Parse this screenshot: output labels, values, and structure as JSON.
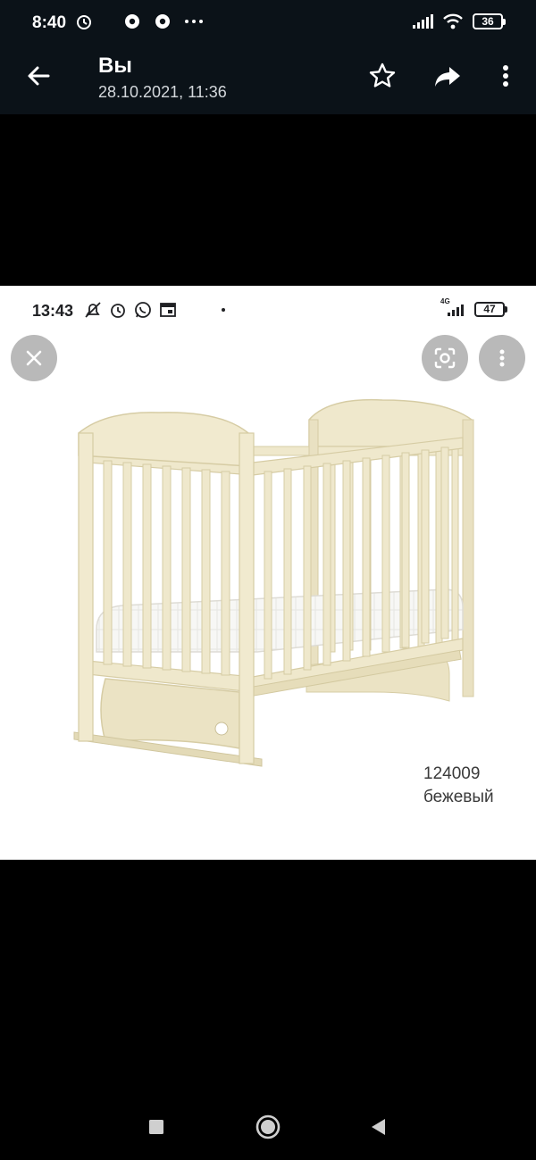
{
  "status_bar": {
    "time": "8:40",
    "battery": "36",
    "left_icons": [
      "alarm-icon",
      "chrome-icon",
      "chrome-icon",
      "more-notifications-icon"
    ],
    "right_icons": [
      "signal-icon",
      "wifi-icon",
      "battery-icon"
    ]
  },
  "app_bar": {
    "title": "Вы",
    "subtitle": "28.10.2021, 11:36",
    "actions": [
      "star-icon",
      "share-icon",
      "overflow-menu-icon"
    ]
  },
  "photo": {
    "inner_status": {
      "time": "13:43",
      "network": "4G",
      "battery": "47",
      "icons": [
        "mute-alarm-icon",
        "alarm-icon",
        "whatsapp-icon",
        "calendar-icon",
        "dot-icon",
        "signal-icon",
        "battery-icon"
      ]
    },
    "buttons": [
      "close-icon",
      "lens-icon",
      "overflow-menu-icon"
    ],
    "product": {
      "code": "124009",
      "color_label": "бежевый"
    }
  },
  "nav_bar": {
    "buttons": [
      "recents-icon",
      "home-icon",
      "back-icon"
    ]
  },
  "colors": {
    "bar_bg": "#0b1218",
    "crib_wood": "#efe8cc",
    "crib_shadow": "#dcd3ad"
  }
}
